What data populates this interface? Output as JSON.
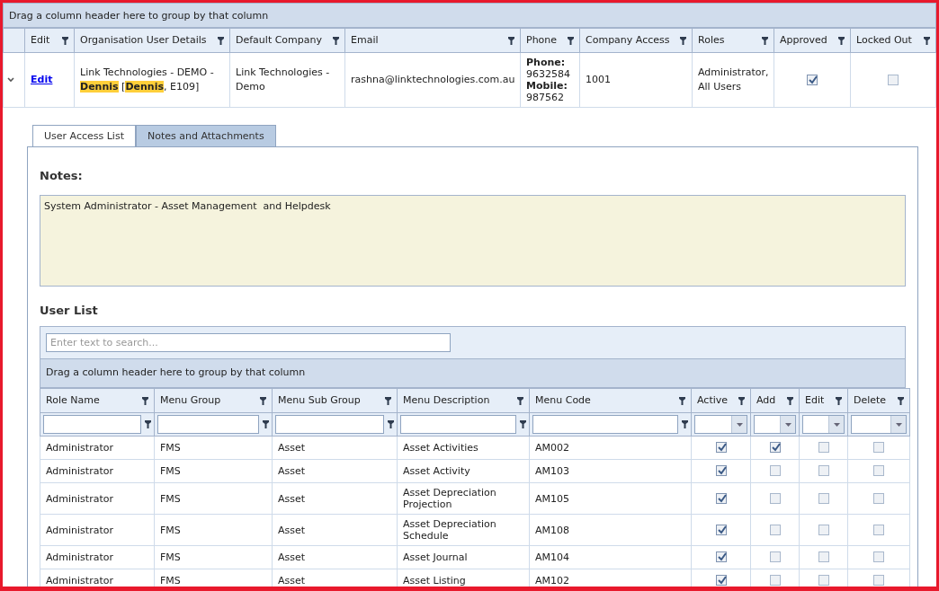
{
  "grid": {
    "group_panel": "Drag a column header here to group by that column",
    "columns": [
      {
        "label": "Edit"
      },
      {
        "label": "Organisation User Details"
      },
      {
        "label": "Default Company"
      },
      {
        "label": "Email"
      },
      {
        "label": "Phone"
      },
      {
        "label": "Company Access"
      },
      {
        "label": "Roles"
      },
      {
        "label": "Approved"
      },
      {
        "label": "Locked Out"
      }
    ],
    "rows": [
      {
        "expanded": true,
        "edit_link": "Edit",
        "org_details": "Link Technologies - DEMO - **Dennis** [**Dennis**, E109]",
        "default_company": "Link Technologies - Demo",
        "email": "rashna@linktechnologies.com.au",
        "phone": [
          {
            "label": "Phone:",
            "value": "9632584"
          },
          {
            "label": "Mobile:",
            "value": "987562"
          }
        ],
        "company_access": "1001",
        "roles": "Administrator, All Users",
        "approved": true,
        "locked_out": false
      }
    ]
  },
  "detail": {
    "tabs": [
      {
        "label": "User Access List",
        "selected": true
      },
      {
        "label": "Notes and Attachments",
        "selected": false
      }
    ],
    "notes_label": "Notes:",
    "notes": "System Administrator - Asset Management  and Helpdesk",
    "user_list_title": "User List",
    "search": {
      "placeholder": "Enter text to search..."
    },
    "group_panel": "Drag a column header here to group by that column",
    "columns": [
      {
        "label": "Role Name",
        "kind": "text"
      },
      {
        "label": "Menu Group",
        "kind": "text"
      },
      {
        "label": "Menu Sub Group",
        "kind": "text"
      },
      {
        "label": "Menu Description",
        "kind": "text"
      },
      {
        "label": "Menu Code",
        "kind": "text"
      },
      {
        "label": "Active",
        "kind": "dropdown"
      },
      {
        "label": "Add",
        "kind": "dropdown"
      },
      {
        "label": "Edit",
        "kind": "dropdown"
      },
      {
        "label": "Delete",
        "kind": "dropdown"
      }
    ],
    "rows": [
      {
        "role_name": "Administrator",
        "menu_group": "FMS",
        "menu_sub_group": "Asset",
        "menu_description": "Asset Activities",
        "menu_code": "AM002",
        "active": true,
        "add": true,
        "edit": false,
        "delete": false
      },
      {
        "role_name": "Administrator",
        "menu_group": "FMS",
        "menu_sub_group": "Asset",
        "menu_description": "Asset Activity",
        "menu_code": "AM103",
        "active": true,
        "add": false,
        "edit": false,
        "delete": false
      },
      {
        "role_name": "Administrator",
        "menu_group": "FMS",
        "menu_sub_group": "Asset",
        "menu_description": "Asset Depreciation Projection",
        "menu_code": "AM105",
        "active": true,
        "add": false,
        "edit": false,
        "delete": false
      },
      {
        "role_name": "Administrator",
        "menu_group": "FMS",
        "menu_sub_group": "Asset",
        "menu_description": "Asset Depreciation Schedule",
        "menu_code": "AM108",
        "active": true,
        "add": false,
        "edit": false,
        "delete": false
      },
      {
        "role_name": "Administrator",
        "menu_group": "FMS",
        "menu_sub_group": "Asset",
        "menu_description": "Asset Journal",
        "menu_code": "AM104",
        "active": true,
        "add": false,
        "edit": false,
        "delete": false
      },
      {
        "role_name": "Administrator",
        "menu_group": "FMS",
        "menu_sub_group": "Asset",
        "menu_description": "Asset Listing",
        "menu_code": "AM102",
        "active": true,
        "add": false,
        "edit": false,
        "delete": false
      }
    ]
  }
}
